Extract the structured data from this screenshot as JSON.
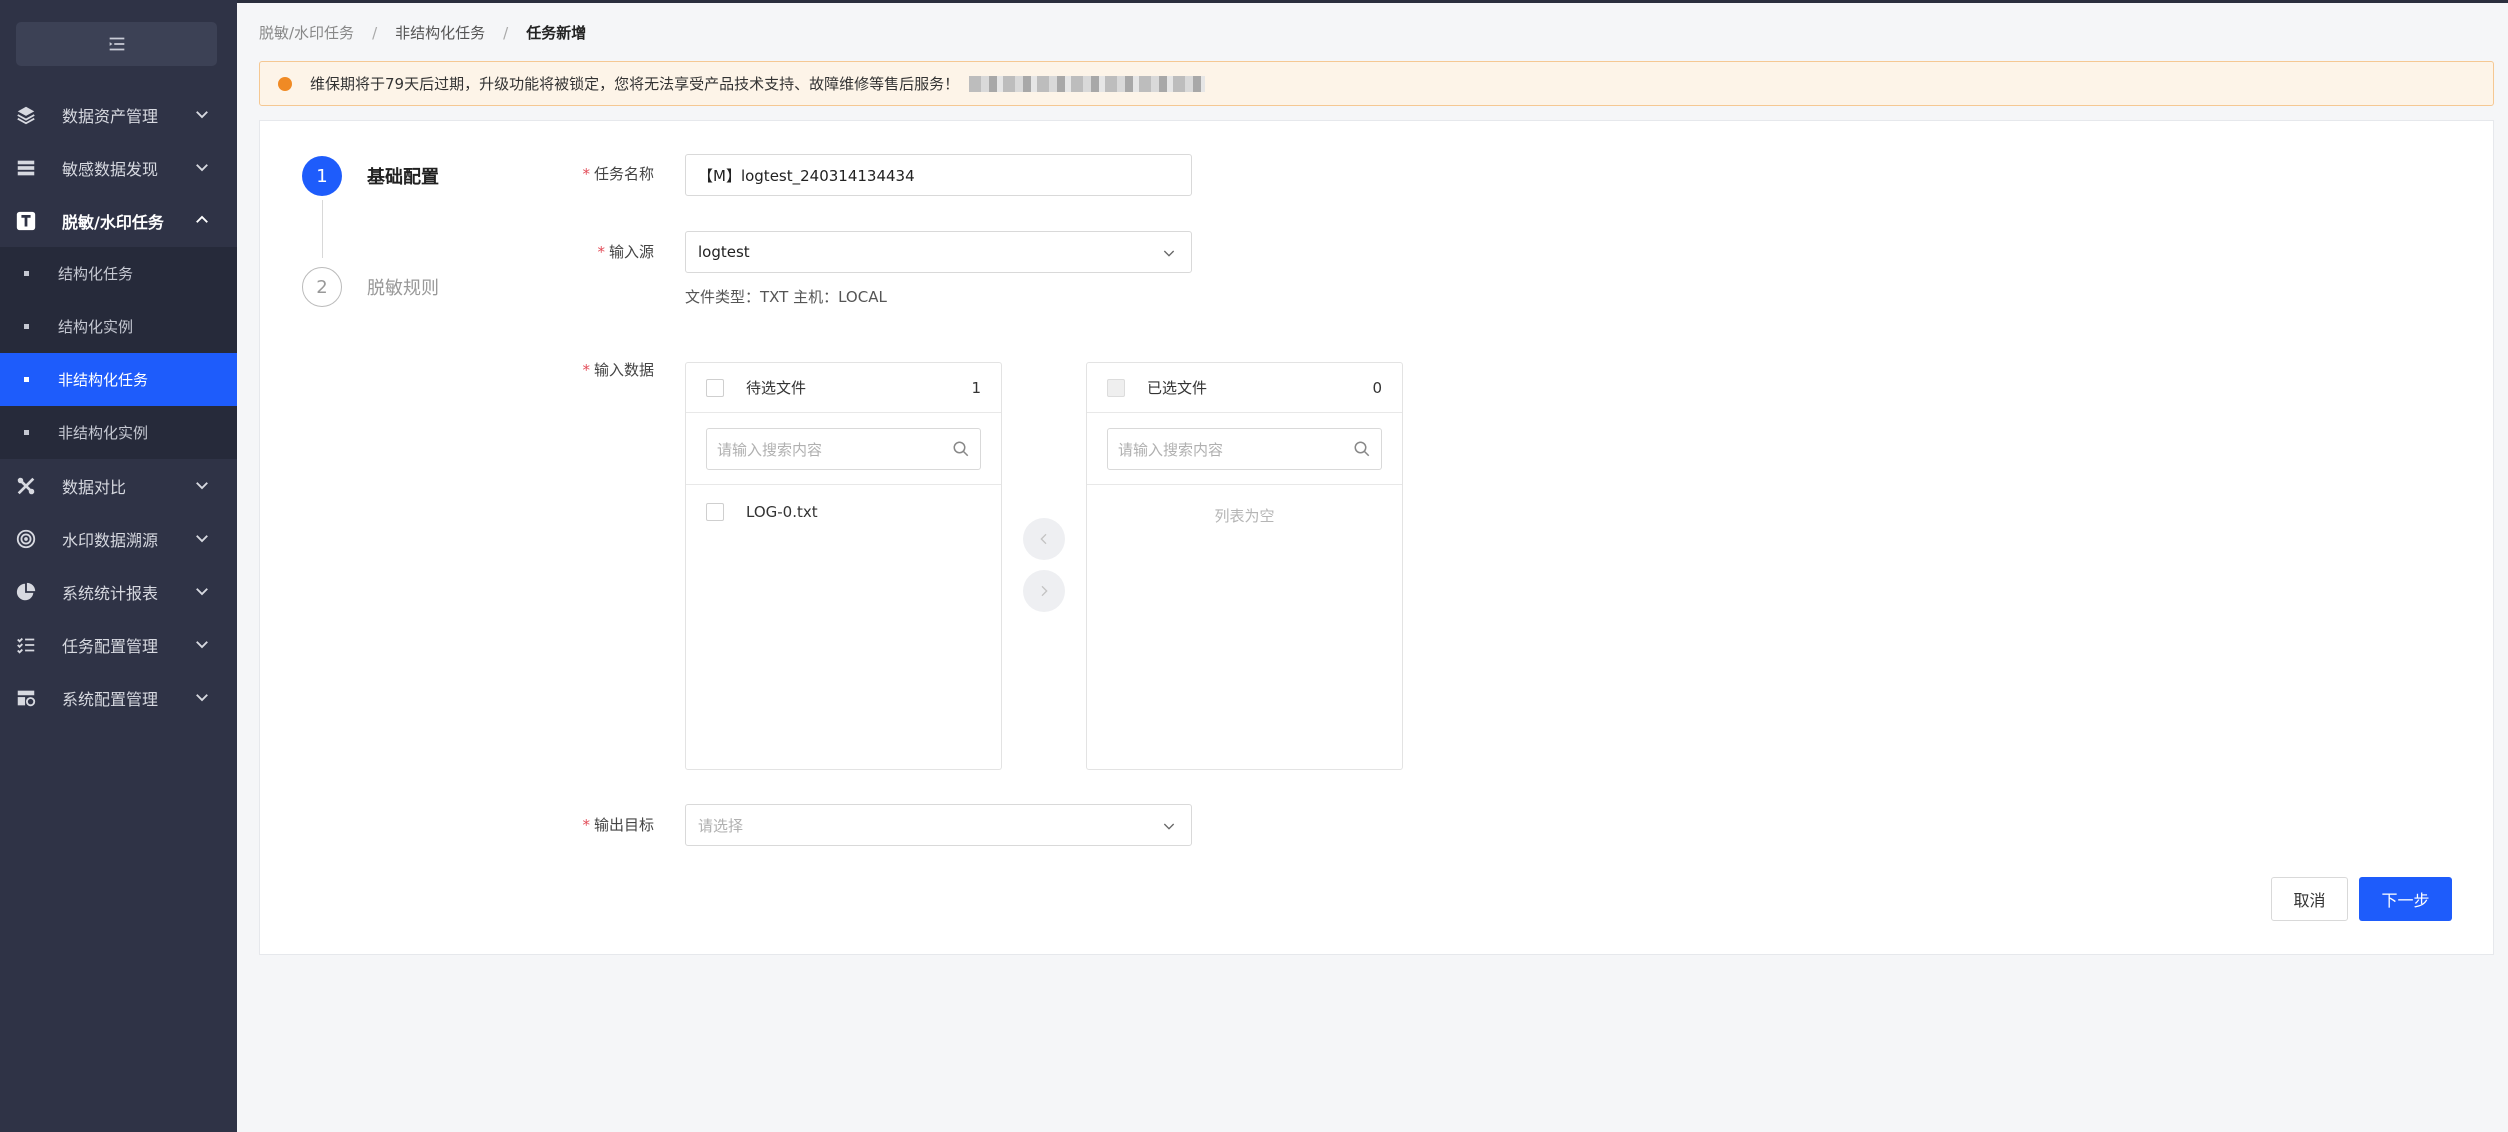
{
  "sidebar": {
    "items": [
      {
        "label": "数据资产管理"
      },
      {
        "label": "敏感数据发现"
      },
      {
        "label": "脱敏/水印任务"
      },
      {
        "label": "数据对比"
      },
      {
        "label": "水印数据溯源"
      },
      {
        "label": "系统统计报表"
      },
      {
        "label": "任务配置管理"
      },
      {
        "label": "系统配置管理"
      }
    ],
    "subitems": [
      {
        "label": "结构化任务"
      },
      {
        "label": "结构化实例"
      },
      {
        "label": "非结构化任务"
      },
      {
        "label": "非结构化实例"
      }
    ]
  },
  "breadcrumb": {
    "items": [
      "脱敏/水印任务",
      "非结构化任务",
      "任务新增"
    ],
    "separator": "/"
  },
  "notice": {
    "text": "维保期将于79天后过期，升级功能将被锁定，您将无法享受产品技术支持、故障维修等售后服务！"
  },
  "steps": [
    {
      "number": "1",
      "label": "基础配置"
    },
    {
      "number": "2",
      "label": "脱敏规则"
    }
  ],
  "form": {
    "required_mark": "*",
    "task_name": {
      "label": "任务名称",
      "value": "【M】logtest_240314134434"
    },
    "input_source": {
      "label": "输入源",
      "value": "logtest",
      "hint": "文件类型：TXT 主机：LOCAL"
    },
    "input_data": {
      "label": "输入数据"
    },
    "output_target": {
      "label": "输出目标",
      "placeholder": "请选择"
    }
  },
  "transfer": {
    "left": {
      "title": "待选文件",
      "count": "1",
      "search_placeholder": "请输入搜索内容",
      "items": [
        "LOG-0.txt"
      ]
    },
    "right": {
      "title": "已选文件",
      "count": "0",
      "search_placeholder": "请输入搜索内容",
      "empty_text": "列表为空"
    }
  },
  "buttons": {
    "cancel": "取消",
    "next": "下一步"
  },
  "colors": {
    "primary": "#1e5cfb",
    "sidebar_bg": "#2f3346",
    "notice_bg": "#fdf4e8",
    "warning": "#f08a24",
    "required": "#e34d59"
  }
}
